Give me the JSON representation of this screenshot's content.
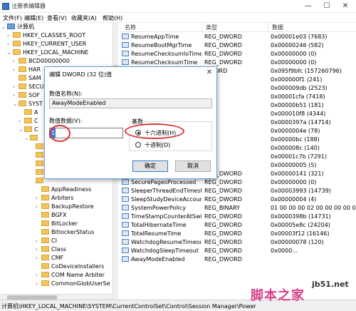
{
  "window": {
    "title": "注册表编辑器",
    "controls": {
      "minimize": "—",
      "maximize": "☐",
      "close": "✕"
    }
  },
  "menu": [
    "文件(F)",
    "编辑(E)",
    "查看(V)",
    "收藏夹(A)",
    "帮助(H)"
  ],
  "tree": {
    "root": "计算机",
    "nodes": [
      {
        "label": "HKEY_CLASSES_ROOT",
        "arrow": "›"
      },
      {
        "label": "HKEY_CURRENT_USER",
        "arrow": "›"
      },
      {
        "label": "HKEY_LOCAL_MACHINE",
        "arrow": "⌄"
      },
      {
        "label": "BCD00000000",
        "arrow": "›"
      },
      {
        "label": "HAR",
        "arrow": "›"
      },
      {
        "label": "SAM",
        "arrow": ""
      },
      {
        "label": "SECU",
        "arrow": "›"
      },
      {
        "label": "SOF",
        "arrow": "›"
      },
      {
        "label": "SYST",
        "arrow": "⌄"
      },
      {
        "label": "A",
        "arrow": ""
      },
      {
        "label": "C",
        "arrow": "›"
      },
      {
        "label": "C",
        "arrow": "⌄"
      },
      {
        "label": "",
        "arrow": "⌄"
      },
      {
        "label": "",
        "arrow": ""
      },
      {
        "label": "",
        "arrow": ""
      },
      {
        "label": "",
        "arrow": ""
      },
      {
        "label": "",
        "arrow": ""
      },
      {
        "label": "",
        "arrow": ""
      },
      {
        "label": "AppReadiness",
        "arrow": ""
      },
      {
        "label": "Arbiters",
        "arrow": "›"
      },
      {
        "label": "BackupRestore",
        "arrow": "›"
      },
      {
        "label": "BGFX",
        "arrow": ""
      },
      {
        "label": "BitLocker",
        "arrow": ""
      },
      {
        "label": "BitlockerStatus",
        "arrow": ""
      },
      {
        "label": "CI",
        "arrow": "›"
      },
      {
        "label": "Class",
        "arrow": "›"
      },
      {
        "label": "CMF",
        "arrow": "›"
      },
      {
        "label": "CoDeviceInstallers",
        "arrow": ""
      },
      {
        "label": "COM Name Arbiter",
        "arrow": "›"
      },
      {
        "label": "CommonGlobUserSe",
        "arrow": "›"
      }
    ]
  },
  "columns": {
    "name": "名称",
    "type": "类型",
    "data": "数据"
  },
  "rows": [
    {
      "name": "ResumeAppTime",
      "type": "REG_DWORD",
      "data": "0x00001e03 (7683)"
    },
    {
      "name": "ResumeBootMgrTime",
      "type": "REG_DWORD",
      "data": "0x00000246 (582)"
    },
    {
      "name": "ResumeChecksumIoTime",
      "type": "REG_DWORD",
      "data": "0x00000000 (0)"
    },
    {
      "name": "ResumeChecksumTime",
      "type": "REG_DWORD",
      "data": "0x00000000 (0)"
    },
    {
      "name": "",
      "type": "QWORD",
      "data": "0x095f9bfc (157260796)"
    },
    {
      "name": "",
      "type": "",
      "data": "0x000000f1 (241)"
    },
    {
      "name": "",
      "type": "",
      "data": "0x000009db (2523)"
    },
    {
      "name": "",
      "type": "",
      "data": "0x00001cfa (7418)"
    },
    {
      "name": "",
      "type": "",
      "data": "0x00000b51 (181)"
    },
    {
      "name": "",
      "type": "",
      "data": "0x000010f8 (4344)"
    },
    {
      "name": "",
      "type": "",
      "data": "0x0000397a (14714)"
    },
    {
      "name": "",
      "type": "",
      "data": "0x0000004e (78)"
    },
    {
      "name": "",
      "type": "",
      "data": "0x00000bc (188)"
    },
    {
      "name": "",
      "type": "",
      "data": "0x000008c (140)"
    },
    {
      "name": "",
      "type": "",
      "data": "0x00001c7b (7291)"
    },
    {
      "name": "",
      "type": "",
      "data": "0x00000005 (5)"
    },
    {
      "name": "ResumeUserInOutTime",
      "type": "REG_DWORD",
      "data": "0x00000141 (321)"
    },
    {
      "name": "SecurePagesProcessed",
      "type": "REG_DWORD",
      "data": "0x00000000 (0)"
    },
    {
      "name": "SleeperThreadEndTimest...",
      "type": "REG_DWORD",
      "data": "0x00003993 (14739)"
    },
    {
      "name": "SleepStudyDeviceAccoun...",
      "type": "REG_DWORD",
      "data": "0x00000004 (4)"
    },
    {
      "name": "SystemPowerPolicy",
      "type": "REG_BINARY",
      "data": "01 00 00 00 02 00 00 00 00 00"
    },
    {
      "name": "TimeStampCounterAtSwit...",
      "type": "REG_DWORD",
      "data": "0x0000398b (14731)"
    },
    {
      "name": "TotalHibernateTime",
      "type": "REG_DWORD",
      "data": "0x00005e8c (24204)"
    },
    {
      "name": "TotalResumeTime",
      "type": "REG_DWORD",
      "data": "0x00003f12 (16146)"
    },
    {
      "name": "WatchdogResumeTimeout",
      "type": "REG_DWORD",
      "data": "0x00000078 (120)"
    },
    {
      "name": "WatchdogSleepTimeout",
      "type": "REG_DWORD",
      "data": "0x0000..."
    },
    {
      "name": "AwayModeEnabled",
      "type": "REG_DWORD",
      "data": ""
    }
  ],
  "status": "计算机\\HKEY_LOCAL_MACHINE\\SYSTEM\\CurrentControlSet\\Control\\Session Manager\\Power",
  "dialog": {
    "title": "编辑 DWORD (32 位)值",
    "close": "✕",
    "name_label": "数值名称(N):",
    "name_value": "AwayModeEnabled",
    "data_label": "数值数据(V):",
    "data_value": "1",
    "base_label": "基数",
    "hex_label": "十六进制(H)",
    "dec_label": "十进制(D)",
    "ok": "确定",
    "cancel": "取消"
  },
  "watermark": {
    "site": "jb51.net",
    "text": "脚本之家"
  },
  "colors": {
    "annotation": "#d8323a",
    "accent": "#3a78d8"
  }
}
